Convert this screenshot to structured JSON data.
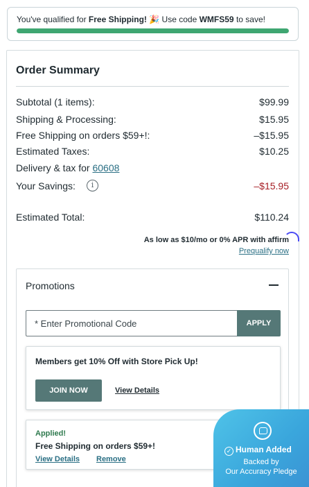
{
  "shipping_banner": {
    "text_pre": "You've qualified for ",
    "text_bold": "Free Shipping!",
    "emoji": "🎉",
    "text_mid": " Use code ",
    "code": "WMFS59",
    "text_post": " to save!",
    "progress_fraction": 1.0
  },
  "summary": {
    "title": "Order Summary",
    "lines": [
      {
        "label": "Subtotal (1 items):",
        "value": "$99.99"
      },
      {
        "label": "Shipping & Processing:",
        "value": "$15.95"
      },
      {
        "label": "Free Shipping on orders $59+!:",
        "value": "–$15.95"
      },
      {
        "label": "Estimated Taxes:",
        "value": "$10.25"
      }
    ],
    "delivery_label": "Delivery & tax for ",
    "delivery_zip": "60608",
    "savings_label": "Your Savings:",
    "savings_info_icon": "i",
    "savings_value": "–$15.95",
    "total_label": "Estimated Total:",
    "total_value": "$110.24",
    "affirm_text": "As low as $10/mo or 0% APR with ",
    "affirm_logo": "affirm",
    "prequalify_link": "Prequalify now"
  },
  "promotions": {
    "title": "Promotions",
    "input_placeholder": "* Enter Promotional Code",
    "apply_label": "APPLY",
    "members_card": {
      "title": "Members get 10% Off with Store Pick Up!",
      "join_label": "JOIN NOW",
      "details_link": "View Details"
    },
    "applied_card": {
      "status": "Applied!",
      "title": "Free Shipping on orders $59+!",
      "details_link": "View Details",
      "remove_link": "Remove"
    }
  },
  "badge": {
    "title": "Human Added",
    "check": "✓",
    "line1": "Backed by",
    "line2": "Our Accuracy Pledge"
  },
  "colors": {
    "accent_button": "#557877",
    "progress_green": "#3fa671",
    "savings_red": "#a61d24",
    "link_teal": "#2a6f84"
  }
}
